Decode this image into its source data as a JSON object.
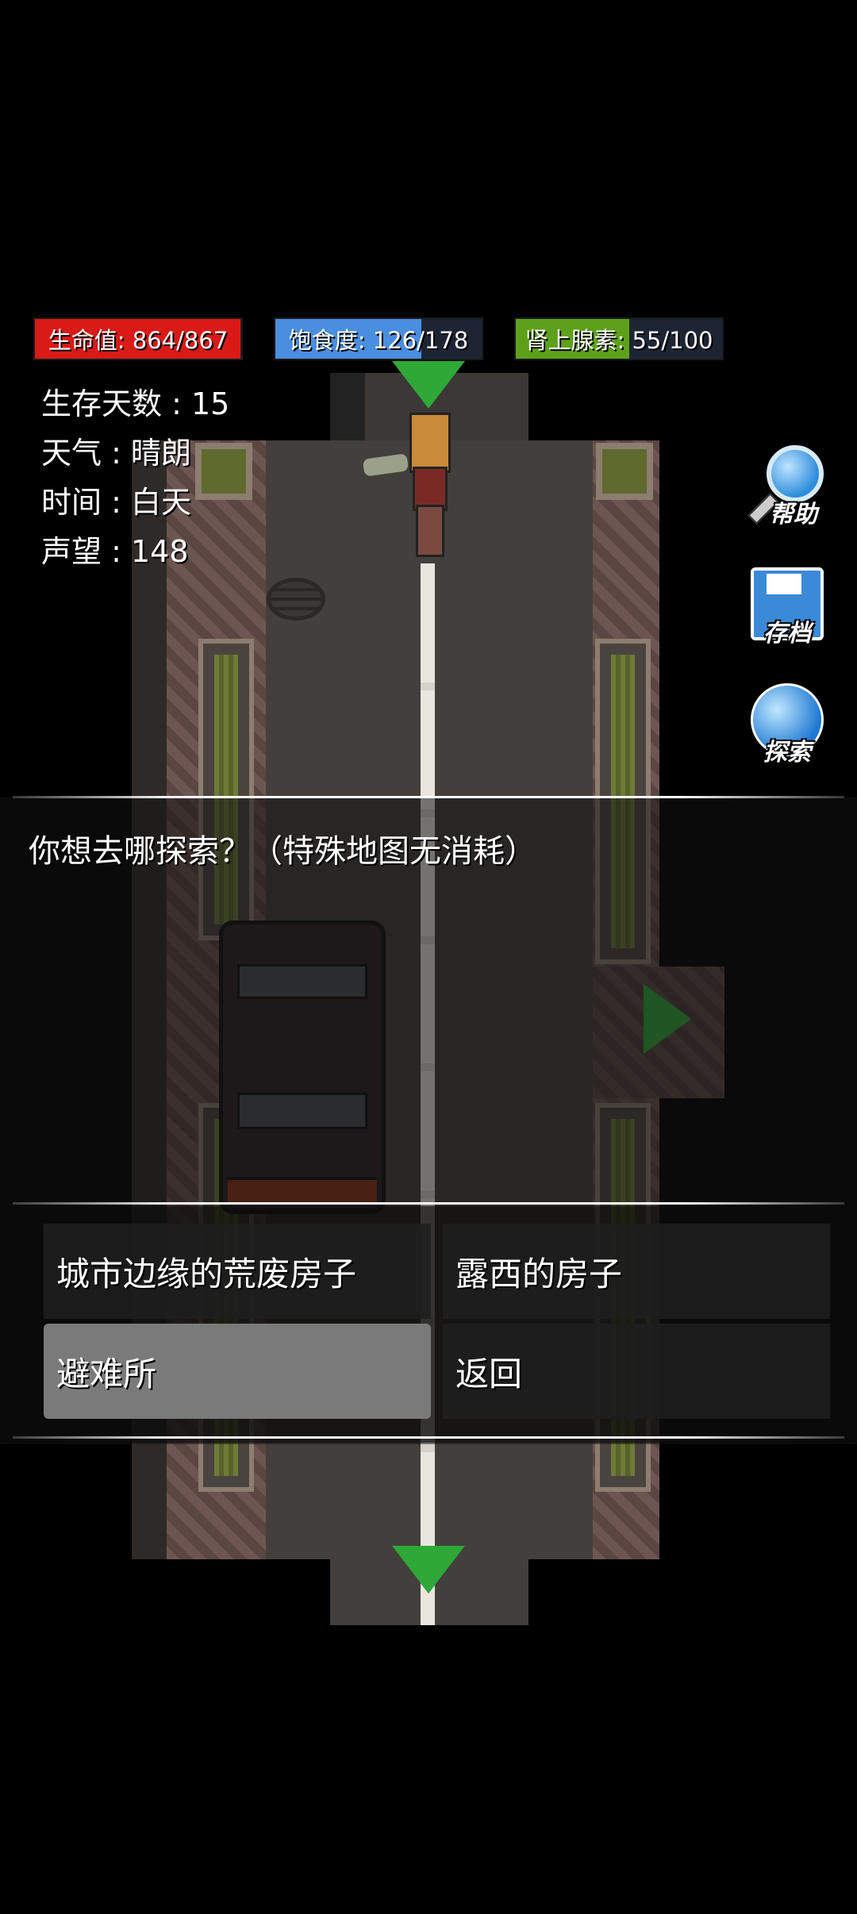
{
  "status_bars": {
    "hp": {
      "label": "生命值: 864/867",
      "fraction": 0.997,
      "color": "#d91a16"
    },
    "hunger": {
      "label": "饱食度: 126/178",
      "fraction": 0.708,
      "color": "#4a8ee0"
    },
    "adrenaline": {
      "label": "肾上腺素: 55/100",
      "fraction": 0.55,
      "color": "#5da11b"
    }
  },
  "stats": {
    "days": "生存天数 : 15",
    "weather": "天气 : 晴朗",
    "time": "时间 : 白天",
    "reputation": "声望 : 148"
  },
  "side_buttons": {
    "help": "帮助",
    "save": "存档",
    "explore": "探索"
  },
  "dialog": {
    "prompt": "你想去哪探索？（特殊地图无消耗）",
    "options": [
      {
        "label": "城市边缘的荒废房子",
        "selected": false
      },
      {
        "label": "露西的房子",
        "selected": false
      },
      {
        "label": "避难所",
        "selected": true
      },
      {
        "label": "返回",
        "selected": false
      }
    ]
  },
  "colors": {
    "arrow_green": "#2fa838",
    "background": "#000000"
  }
}
